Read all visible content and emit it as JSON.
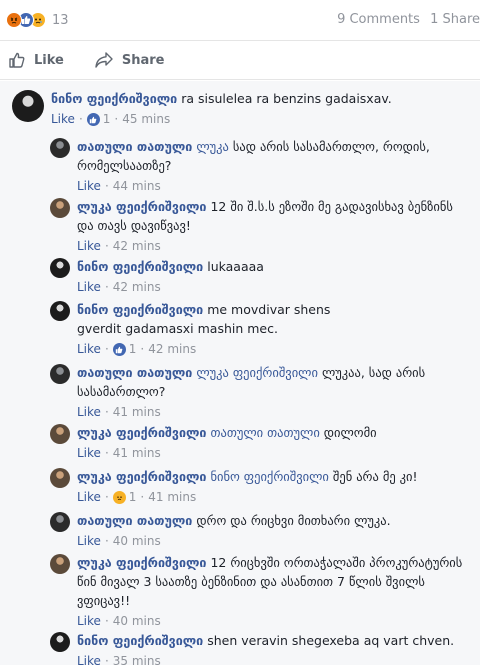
{
  "stats": {
    "reaction_count": "13",
    "comments": "9 Comments",
    "shares": "1 Share"
  },
  "actions": {
    "like_label": "Like",
    "share_label": "Share"
  },
  "comments": [
    {
      "author": "ნინო ფეიქრიშვილი",
      "mention": "",
      "text": "ra sisulelea ra benzins gadaisxav.",
      "like": "Like",
      "reaction": "like",
      "reaction_count": "1",
      "time": "45 mins"
    },
    {
      "author": "თათული თათული",
      "mention": "ლუკა",
      "text": "სად არის სასამართლო, როდის, რომელსაათზე?",
      "like": "Like",
      "time": "44 mins"
    },
    {
      "author": "ლუკა ფეიქრიშვილი",
      "mention": "",
      "text": "12 ში შ.ს.ს ეზოში მე გადავისხავ ბენზინს და თავს დავიწვავ!",
      "like": "Like",
      "time": "42 mins"
    },
    {
      "author": "ნინო ფეიქრიშვილი",
      "mention": "",
      "text": "lukaaaaa",
      "like": "Like",
      "time": "42 mins"
    },
    {
      "author": "ნინო ფეიქრიშვილი",
      "mention": "",
      "text": "me movdivar shens gverdit gadamasxi mashin mec.",
      "like": "Like",
      "reaction": "like",
      "reaction_count": "1",
      "time": "42 mins"
    },
    {
      "author": "თათული თათული",
      "mention": "ლუკა ფეიქრიშვილი",
      "text": "ლუკაა, სად არის სასამართლო?",
      "like": "Like",
      "time": "41 mins"
    },
    {
      "author": "ლუკა ფეიქრიშვილი",
      "mention": "თათული თათული",
      "text": "დილომი",
      "like": "Like",
      "time": "41 mins"
    },
    {
      "author": "ლუკა ფეიქრიშვილი",
      "mention": "ნინო ფეიქრიშვილი",
      "text": "შენ არა მე კი!",
      "like": "Like",
      "reaction": "sad",
      "reaction_count": "1",
      "time": "41 mins"
    },
    {
      "author": "თათული თათული",
      "mention": "",
      "text": "დრო და რიცხვი მითხარი ლუკა.",
      "like": "Like",
      "time": "40 mins"
    },
    {
      "author": "ლუკა ფეიქრიშვილი",
      "mention": "",
      "text": "12 რიცხვში ორთაჭალაში პროკურატურის წინ მივალ 3 საათზე ბენზინით და ასანთით 7 წლის შვილს ვფიცავ!!",
      "like": "Like",
      "time": "40 mins"
    },
    {
      "author": "ნინო ფეიქრიშვილი",
      "mention": "",
      "text": "shen veravin shegexeba aq vart chven.",
      "like": "Like",
      "time": "35 mins"
    }
  ]
}
